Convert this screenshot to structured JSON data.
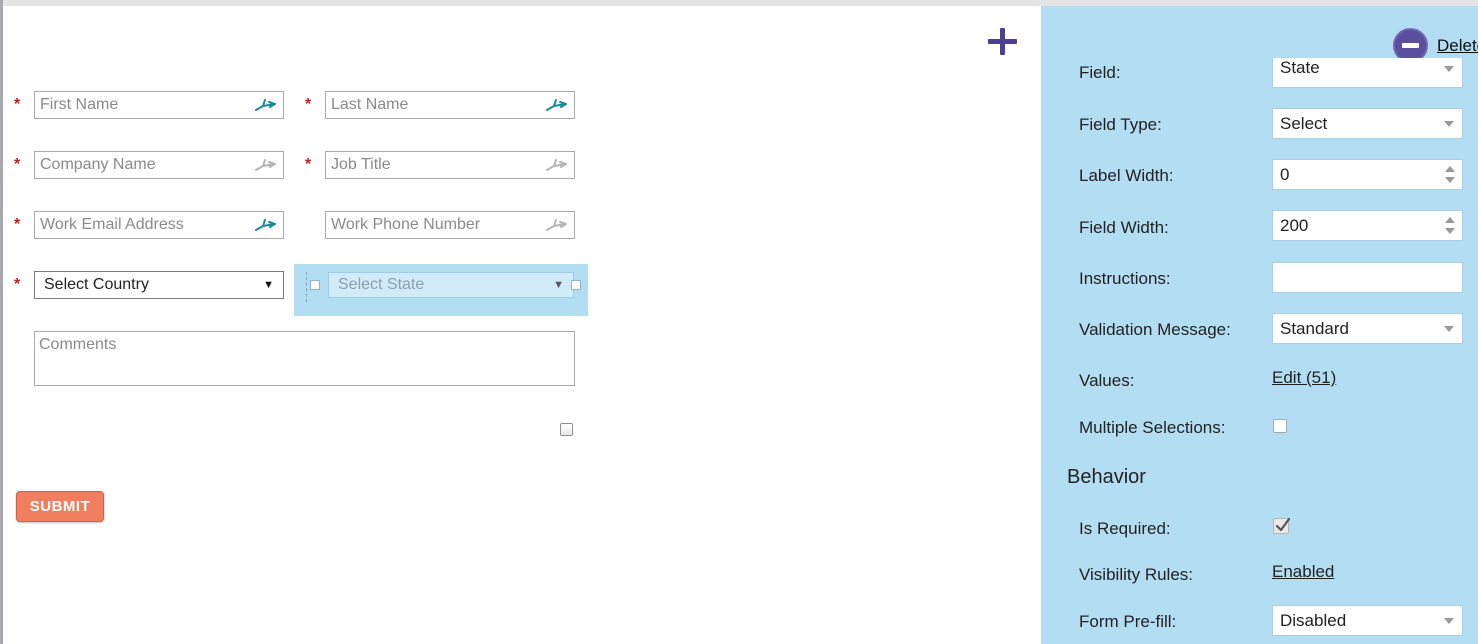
{
  "form": {
    "fields": {
      "first_name": "First Name",
      "last_name": "Last Name",
      "company_name": "Company Name",
      "job_title": "Job Title",
      "work_email": "Work Email Address",
      "work_phone": "Work Phone Number",
      "country_select": "Select Country",
      "state_select": "Select State",
      "comments": "Comments"
    },
    "required_marker": "*",
    "submit_label": "SUBMIT",
    "icons": {
      "add_field": "plus-icon",
      "prefill_active": "prefill-icon",
      "prefill_inactive": "prefill-icon-inactive"
    },
    "colors": {
      "required": "#c0201a",
      "submit_bg": "#ef7f5f",
      "prefill_active": "#1a8a96",
      "selection_bg": "#b3ddf3",
      "add_icon": "#4d3f98"
    }
  },
  "panel": {
    "delete_label": "Delete",
    "delete_icon": "minus-circle-icon",
    "field_label": "Field:",
    "field_value": "State",
    "field_type_label": "Field Type:",
    "field_type_value": "Select",
    "label_width_label": "Label Width:",
    "label_width_value": "0",
    "field_width_label": "Field Width:",
    "field_width_value": "200",
    "instructions_label": "Instructions:",
    "instructions_value": "",
    "validation_label": "Validation Message:",
    "validation_value": "Standard",
    "values_label": "Values:",
    "values_link": "Edit (51)",
    "multiple_label": "Multiple Selections:",
    "multiple_checked": false,
    "behavior_heading": "Behavior",
    "required_label": "Is Required:",
    "required_checked": true,
    "visibility_label": "Visibility Rules:",
    "visibility_link": "Enabled",
    "prefill_label": "Form Pre-fill:",
    "prefill_value": "Disabled",
    "background": "#b3ddf3"
  }
}
